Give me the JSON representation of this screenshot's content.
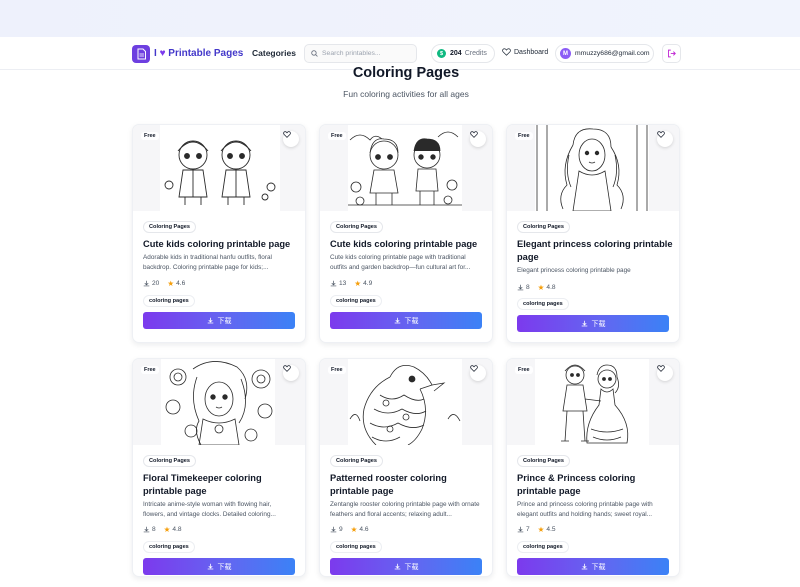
{
  "brand": {
    "name": "I ♥ Printable Pages",
    "prefix": "I",
    "heart": "♥",
    "suffix": "Printable Pages",
    "logo_icon": "document-icon",
    "accent": "#6d3fe0"
  },
  "nav": {
    "categories_label": "Categories",
    "search_placeholder": "Search printables...",
    "credits_value": "204",
    "credits_label": "Credits",
    "dashboard_label": "Dashboard",
    "user_initial": "M",
    "user_email": "mmuzzy686@gmail.com"
  },
  "page": {
    "title": "Coloring Pages",
    "subtitle": "Fun coloring activities for all ages"
  },
  "cards": [
    {
      "badge": "Free",
      "category": "Coloring Pages",
      "title": "Cute kids coloring printable page",
      "description": "Adorable kids in traditional hanfu outfits, floral backdrop. Coloring printable page for kids;...",
      "downloads": "20",
      "rating": "4.6",
      "tag": "coloring pages",
      "button": "下载"
    },
    {
      "badge": "Free",
      "category": "Coloring Pages",
      "title": "Cute kids coloring printable page",
      "description": "Cute kids coloring printable page with traditional outfits and garden backdrop—fun cultural art for...",
      "downloads": "13",
      "rating": "4.9",
      "tag": "coloring pages",
      "button": "下载"
    },
    {
      "badge": "Free",
      "category": "Coloring Pages",
      "title": "Elegant princess coloring printable page",
      "description": "Elegant princess coloring printable page",
      "downloads": "8",
      "rating": "4.8",
      "tag": "coloring pages",
      "button": "下载"
    },
    {
      "badge": "Free",
      "category": "Coloring Pages",
      "title": "Floral Timekeeper coloring printable page",
      "description": "Intricate anime-style woman with flowing hair, flowers, and vintage clocks. Detailed coloring...",
      "downloads": "8",
      "rating": "4.8",
      "tag": "coloring pages",
      "button": "下载"
    },
    {
      "badge": "Free",
      "category": "Coloring Pages",
      "title": "Patterned rooster coloring printable page",
      "description": "Zentangle rooster coloring printable page with ornate feathers and floral accents; relaxing adult...",
      "downloads": "9",
      "rating": "4.6",
      "tag": "coloring pages",
      "button": "下载"
    },
    {
      "badge": "Free",
      "category": "Coloring Pages",
      "title": "Prince & Princess coloring printable page",
      "description": "Prince and princess coloring printable page with elegant outfits and holding hands; sweet royal...",
      "downloads": "7",
      "rating": "4.5",
      "tag": "coloring pages",
      "button": "下载"
    }
  ]
}
